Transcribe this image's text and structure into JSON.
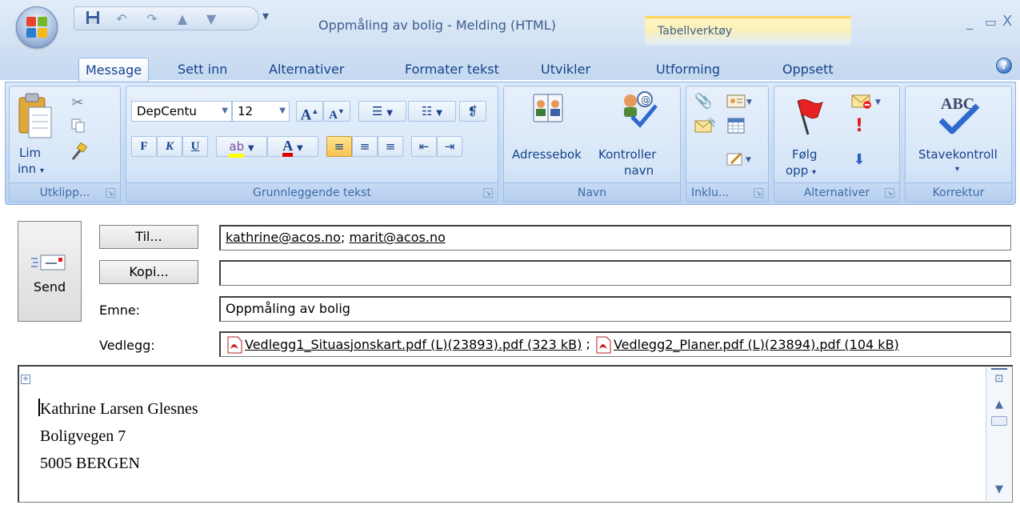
{
  "window": {
    "title": "Oppmåling av bolig - Melding (HTML)",
    "context_tab_title": "Tabellverktøy",
    "customize_symbol": "▾",
    "min_symbol": "_",
    "max_symbol": "▭",
    "close_symbol": "X"
  },
  "tabs": [
    {
      "label": "Message"
    },
    {
      "label": "Sett inn"
    },
    {
      "label": "Alternativer"
    },
    {
      "label": "Formater tekst"
    },
    {
      "label": "Utvikler"
    },
    {
      "label": "Utforming"
    },
    {
      "label": "Oppsett"
    }
  ],
  "ribbon": {
    "clipboard": {
      "paste_label_1": "Lim",
      "paste_label_2": "inn",
      "group_label": "Utklipp...",
      "arrow": "▾"
    },
    "basic_text": {
      "font_name": "DepCentu",
      "font_size": "12",
      "bold": "F",
      "italic": "K",
      "underline": "U",
      "grow": "A",
      "shrink": "A",
      "group_label": "Grunnleggende tekst"
    },
    "names": {
      "address_book": "Adressebok",
      "check_names_1": "Kontroller",
      "check_names_2": "navn",
      "group_label": "Navn"
    },
    "include": {
      "group_label": "Inklu..."
    },
    "options": {
      "follow_up_1": "Følg",
      "follow_up_2": "opp",
      "group_label": "Alternativer",
      "arrow": "▾",
      "high_importance": "!",
      "low_importance": "⬇"
    },
    "proofing": {
      "spelling": "Stavekontroll",
      "abc": "ABC",
      "group_label": "Korrektur",
      "arrow": "▾"
    }
  },
  "header": {
    "send_label": "Send",
    "to_button": "Til...",
    "cc_button": "Kopi...",
    "subject_label": "Emne:",
    "attachments_label": "Vedlegg:",
    "to_recipients": [
      "kathrine@acos.no",
      "marit@acos.no"
    ],
    "recipient_separator": ";",
    "cc_value": "",
    "subject_value": "Oppmåling av bolig",
    "attachments": [
      "Vedlegg1_Situasjonskart.pdf (L)(23893).pdf (323 kB)",
      "Vedlegg2_Planer.pdf (L)(23894).pdf (104 kB)"
    ],
    "attachment_separator": ";"
  },
  "body": {
    "lines": [
      "Kathrine Larsen Glesnes",
      "Boligvegen 7",
      "5005 BERGEN"
    ]
  },
  "colors": {
    "ribbon_text": "#15428b",
    "context_tab": "#ffd65d",
    "pdf_red": "#cc1f1f"
  }
}
